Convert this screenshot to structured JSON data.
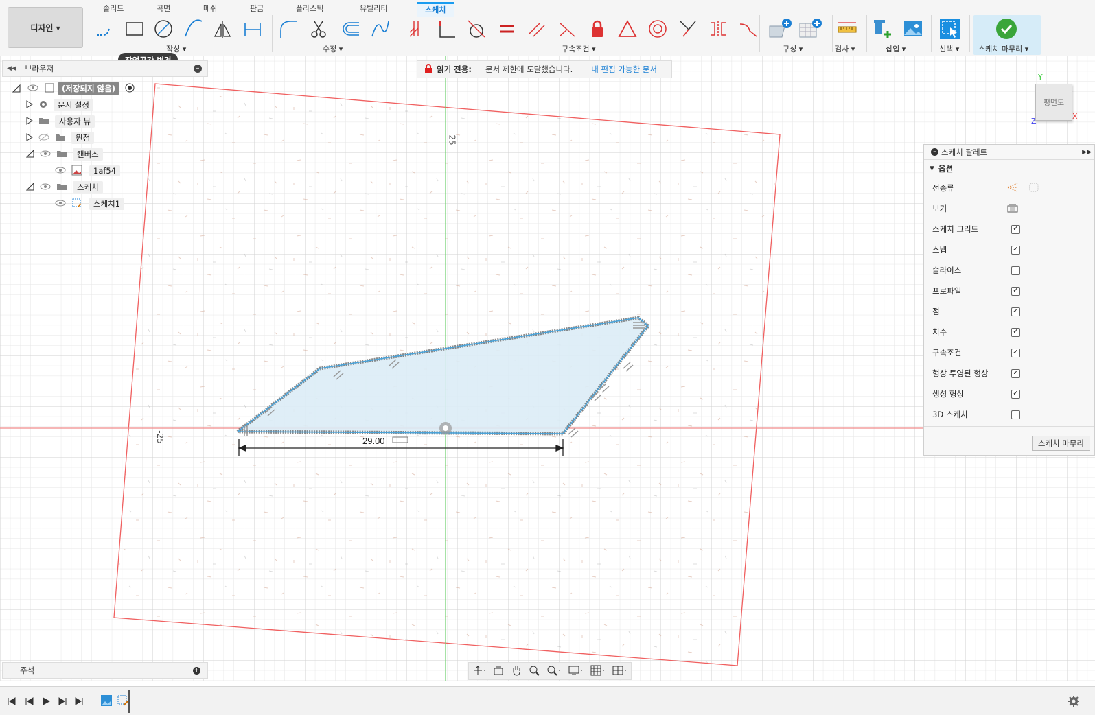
{
  "workspace": {
    "label": "디자인 ▾"
  },
  "tabs": [
    "솔리드",
    "곡면",
    "메쉬",
    "판금",
    "플라스틱",
    "유틸리티",
    "스케치"
  ],
  "active_tab": "스케치",
  "groups": {
    "create": "작성 ▾",
    "modify": "수정 ▾",
    "constraints": "구속조건 ▾",
    "construct": "구성 ▾",
    "inspect": "검사 ▾",
    "insert": "삽입 ▾",
    "select": "선택 ▾",
    "finish": "스케치 마무리 ▾"
  },
  "tooltip": "작업공간 변경",
  "browser": {
    "title": "브라우저",
    "root": "(저장되지 않음)",
    "items": [
      {
        "label": "문서 설정"
      },
      {
        "label": "사용자 뷰"
      },
      {
        "label": "원점"
      },
      {
        "label": "캔버스"
      },
      {
        "label": "1af54"
      },
      {
        "label": "스케치"
      },
      {
        "label": "스케치1"
      }
    ]
  },
  "banner": {
    "title": "읽기 전용:",
    "message": "문서 제한에 도달했습니다.",
    "link": "내 편집 가능한 문서"
  },
  "palette": {
    "title": "스케치 팔레트",
    "section": "옵션",
    "rows": [
      {
        "label": "선종류",
        "kind": "icons"
      },
      {
        "label": "보기",
        "kind": "icon"
      },
      {
        "label": "스케치 그리드",
        "checked": true
      },
      {
        "label": "스냅",
        "checked": true
      },
      {
        "label": "슬라이스",
        "checked": false
      },
      {
        "label": "프로파일",
        "checked": true
      },
      {
        "label": "점",
        "checked": true
      },
      {
        "label": "치수",
        "checked": true
      },
      {
        "label": "구속조건",
        "checked": true
      },
      {
        "label": "형상 투영된 형상",
        "checked": true
      },
      {
        "label": "생성 형상",
        "checked": true
      },
      {
        "label": "3D 스케치",
        "checked": false
      }
    ],
    "finish_button": "스케치 마무리"
  },
  "canvas": {
    "dimension": "29.00",
    "axis_label_top": "25",
    "axis_label_left": "-25"
  },
  "viewcube": {
    "face": "평면도",
    "axis_y": "Y",
    "axis_x": "X",
    "axis_z": "Z"
  },
  "annotation": {
    "label": "주석"
  },
  "colors": {
    "accent": "#1a9cf0",
    "canvas_border": "#f06060",
    "profile_fill": "#dcecf6",
    "profile_edge": "#4aa3d9",
    "axis_green": "#6ccf6c",
    "axis_red": "#f08080"
  }
}
